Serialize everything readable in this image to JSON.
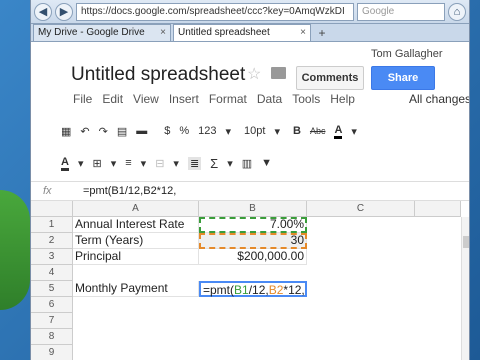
{
  "browser": {
    "url": "https://docs.google.com/spreadsheet/ccc?key=0AmqWzkDI",
    "search_placeholder": "Google",
    "tabs": [
      "My Drive - Google Drive",
      "Untitled spreadsheet"
    ],
    "new_tab": "+"
  },
  "doc": {
    "user": "Tom Gallagher",
    "title": "Untitled spreadsheet",
    "comments": "Comments",
    "share": "Share",
    "menus": [
      "File",
      "Edit",
      "View",
      "Insert",
      "Format",
      "Data",
      "Tools",
      "Help"
    ],
    "saved": "All changes s"
  },
  "toolbar": {
    "currency": "$",
    "percent": "%",
    "format": "123",
    "fontsize": "10pt",
    "bold": "B",
    "strike": "Abc",
    "textcolor": "A",
    "sum": "Σ"
  },
  "formula_bar": {
    "fx": "fx",
    "value": "=pmt(B1/12,B2*12,"
  },
  "columns": [
    "A",
    "B",
    "C"
  ],
  "rows": [
    "1",
    "2",
    "3",
    "4",
    "5",
    "6",
    "7",
    "8",
    "9"
  ],
  "cells": {
    "a1": "Annual Interest Rate",
    "b1": "7.00%",
    "a2": "Term (Years)",
    "b2": "30",
    "a3": "Principal",
    "b3": "$200,000.00",
    "a5": "Monthly Payment",
    "b5_parts": [
      "=pmt(",
      "B1",
      "/12,",
      "B2",
      "*12,"
    ]
  },
  "colors": {
    "ref1": "#3a9d3a",
    "ref2": "#e58a2a",
    "share": "#4a8af4"
  }
}
